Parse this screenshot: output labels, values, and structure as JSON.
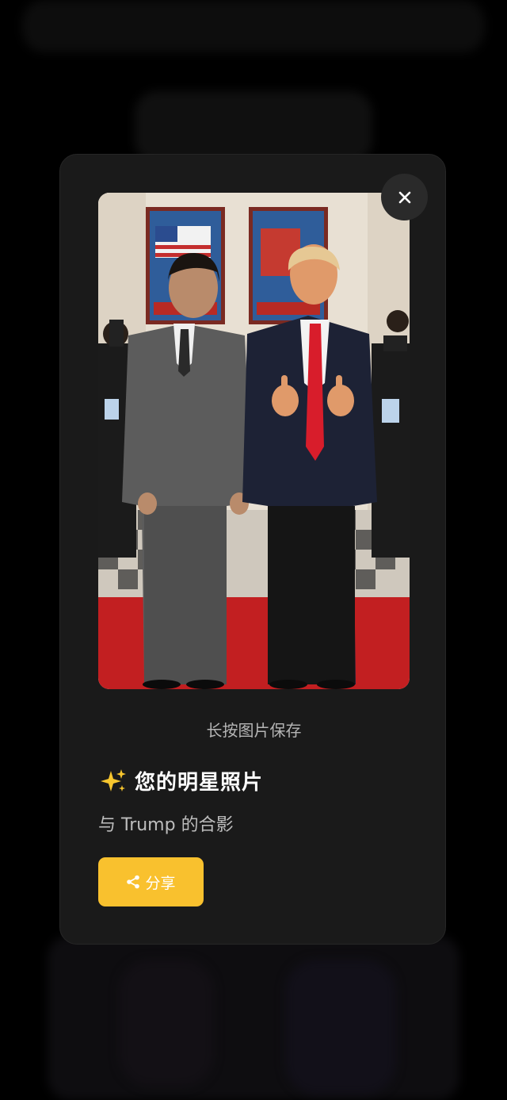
{
  "modal": {
    "hint": "长按图片保存",
    "sparkle_emoji": "✨",
    "title": "您的明星照片",
    "subtitle": "与 Trump 的合影",
    "share_label": "分享",
    "close_icon": "close-icon",
    "share_icon": "share-icon",
    "photo_alt": "Photo of a man standing next to Trump on a red carpet"
  },
  "colors": {
    "background": "#000000",
    "modal": "#1a1a1a",
    "accent": "#f9c12e",
    "title": "#ffffff",
    "muted_text": "#b5b5b5"
  }
}
